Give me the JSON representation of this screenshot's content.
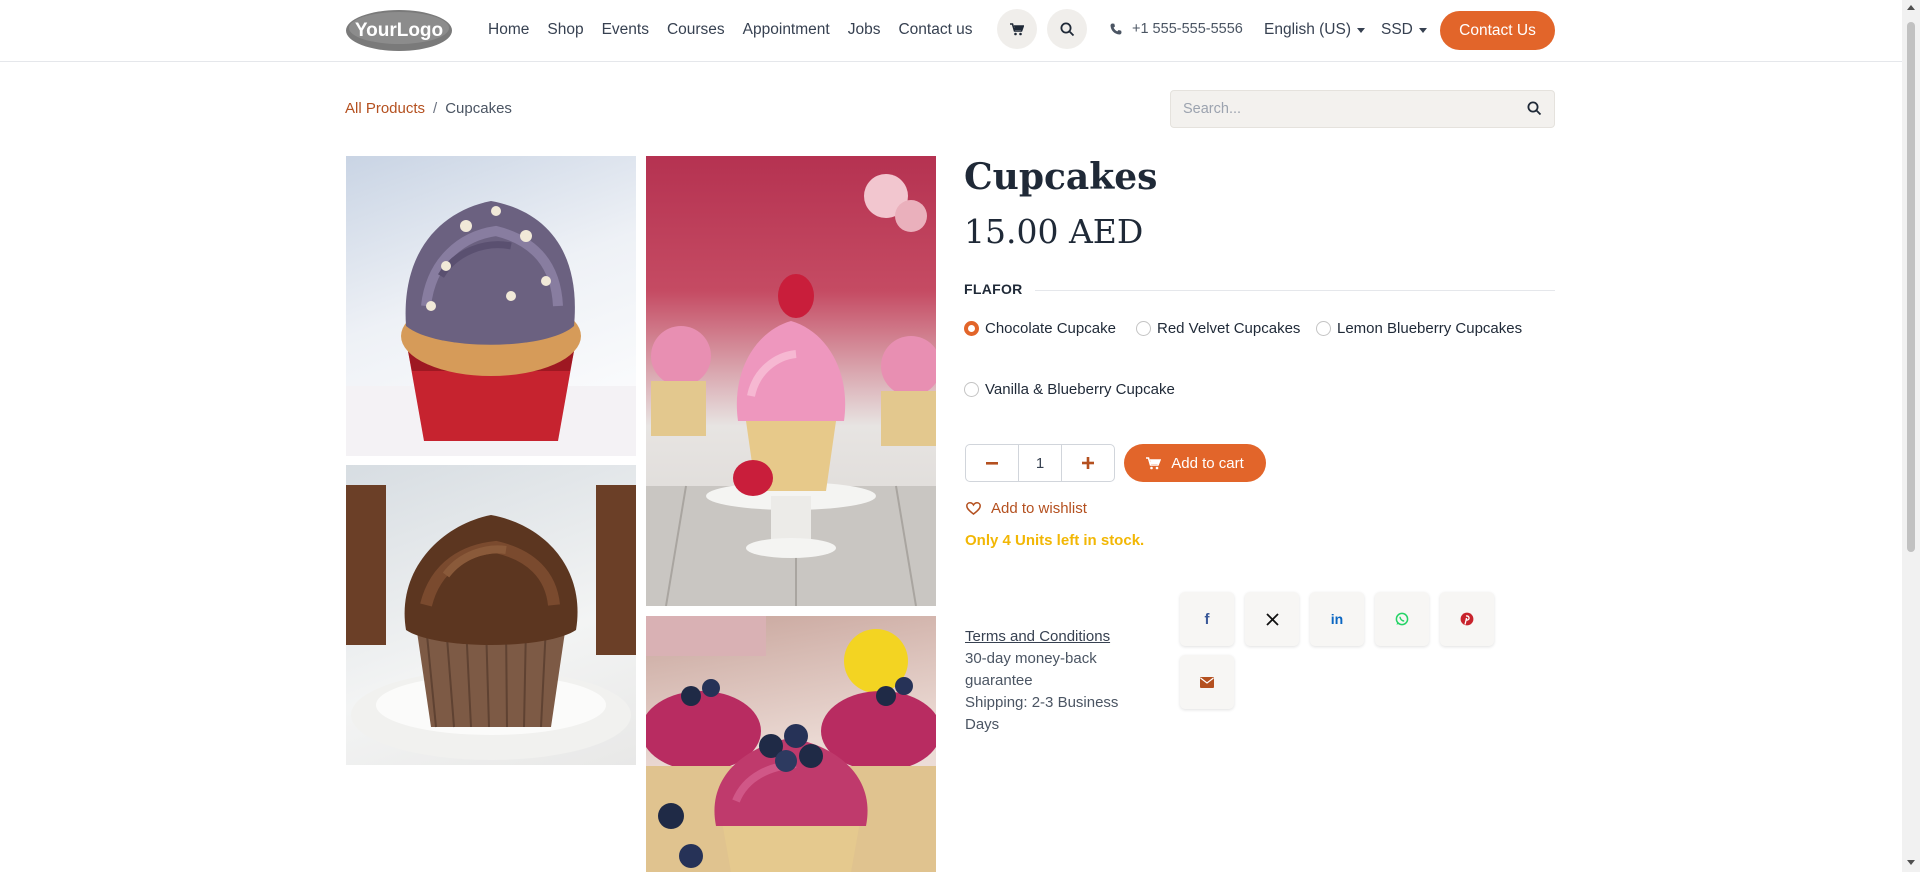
{
  "header": {
    "logo_text": "YourLogo",
    "nav": [
      "Home",
      "Shop",
      "Events",
      "Courses",
      "Appointment",
      "Jobs",
      "Contact us"
    ],
    "phone": "+1 555-555-5556",
    "language": "English (US)",
    "currency": "SSD",
    "contact_button": "Contact Us",
    "icons": {
      "cart": "cart-icon",
      "search": "search-icon",
      "phone": "phone-icon"
    }
  },
  "breadcrumb": {
    "parent": "All Products",
    "separator": "/",
    "current": "Cupcakes"
  },
  "search": {
    "placeholder": "Search..."
  },
  "product": {
    "title": "Cupcakes",
    "price": "15.00 AED",
    "attribute_name": "FLAFOR",
    "options": [
      {
        "label": "Chocolate Cupcake",
        "selected": true
      },
      {
        "label": "Red Velvet Cupcakes",
        "selected": false
      },
      {
        "label": "Lemon Blueberry Cupcakes",
        "selected": false
      },
      {
        "label": "Vanilla & Blueberry Cupcake",
        "selected": false
      }
    ],
    "quantity": "1",
    "minus_symbol": "−",
    "plus_symbol": "+",
    "add_to_cart": "Add to cart",
    "add_to_wishlist": "Add to wishlist",
    "stock_message": "Only 4 Units left in stock.",
    "terms_link": "Terms and Conditions",
    "guarantee": "30-day money-back guarantee",
    "shipping": "Shipping: 2-3 Business Days"
  },
  "share": {
    "icons": [
      "facebook-icon",
      "x-icon",
      "linkedin-icon",
      "whatsapp-icon",
      "pinterest-icon",
      "email-icon"
    ],
    "facebook_label": "f",
    "x_label": "𝕏",
    "linkedin_label": "in"
  },
  "colors": {
    "accent": "#e2652a",
    "link": "#b4501f",
    "stock": "#f2b705",
    "facebook": "#3b5998",
    "linkedin": "#0a66c2",
    "whatsapp": "#25d366",
    "pinterest": "#c8232c",
    "email": "#b4501f"
  }
}
